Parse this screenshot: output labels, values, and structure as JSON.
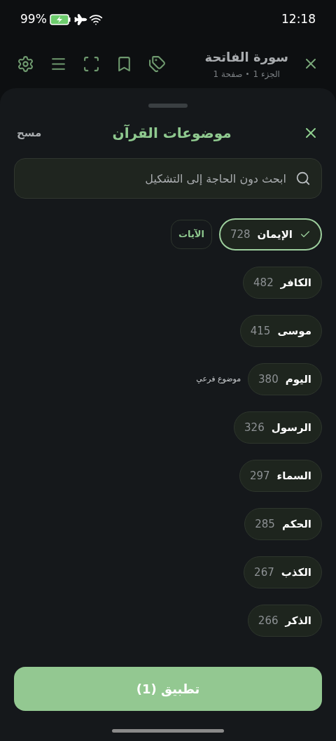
{
  "status_bar": {
    "battery": "99%",
    "time": "12:18"
  },
  "header": {
    "title": "سورة الفاتحة",
    "subtitle_part": "الجزء 1",
    "subtitle_page": "صفحة 1"
  },
  "sheet": {
    "title": "موضوعات القرآن",
    "clear": "مسح",
    "search": {
      "placeholder": "ابحث دون الحاجة إلى التشكيل"
    },
    "topics": [
      {
        "name": "الإيمان",
        "count": "728",
        "selected": true,
        "verses_button": "الآيات"
      },
      {
        "name": "الكافر",
        "count": "482",
        "selected": false
      },
      {
        "name": "موسى",
        "count": "415",
        "selected": false
      },
      {
        "name": "اليوم",
        "count": "380",
        "selected": false,
        "note": "موضوع فرعي"
      },
      {
        "name": "الرسول",
        "count": "326",
        "selected": false
      },
      {
        "name": "السماء",
        "count": "297",
        "selected": false
      },
      {
        "name": "الحكم",
        "count": "285",
        "selected": false
      },
      {
        "name": "الكذب",
        "count": "267",
        "selected": false
      },
      {
        "name": "الذكر",
        "count": "266",
        "selected": false
      }
    ],
    "apply": "تطبيق (1)"
  }
}
